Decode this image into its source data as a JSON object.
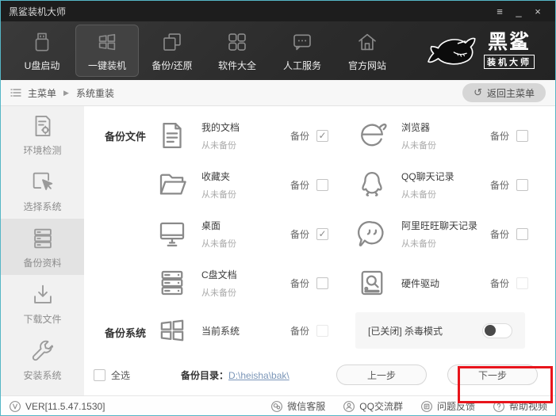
{
  "titlebar": {
    "title": "黑鲨装机大师",
    "menu_glyph": "≡",
    "minimize_glyph": "_",
    "close_glyph": "×"
  },
  "nav": {
    "items": [
      {
        "label": "U盘启动",
        "icon": "usb-icon",
        "active": false
      },
      {
        "label": "一键装机",
        "icon": "onekey-install-icon",
        "active": true
      },
      {
        "label": "备份/还原",
        "icon": "backup-restore-icon",
        "active": false
      },
      {
        "label": "软件大全",
        "icon": "software-icon",
        "active": false
      },
      {
        "label": "人工服务",
        "icon": "support-chat-icon",
        "active": false
      },
      {
        "label": "官方网站",
        "icon": "home-icon",
        "active": false
      }
    ],
    "brand_line1": "黑鲨",
    "brand_line2": "装机大师",
    "brand_icon": "shark-logo"
  },
  "breadcrumb": {
    "root": "主菜单",
    "separator_glyph": "▶",
    "current": "系统重装",
    "back_glyph": "↺",
    "back_label": "返回主菜单"
  },
  "sidebar": {
    "items": [
      {
        "label": "环境检测",
        "icon": "env-check-icon",
        "active": false
      },
      {
        "label": "选择系统",
        "icon": "select-system-icon",
        "active": false
      },
      {
        "label": "备份资料",
        "icon": "backup-data-icon",
        "active": true
      },
      {
        "label": "下载文件",
        "icon": "download-icon",
        "active": false
      },
      {
        "label": "安装系统",
        "icon": "install-wrench-icon",
        "active": false
      }
    ]
  },
  "main": {
    "section_files_label": "备份文件",
    "section_system_label": "备份系统",
    "backup_label": "备份",
    "items": [
      {
        "title": "我的文档",
        "subtitle": "从未备份",
        "checked": true,
        "icon": "document-icon"
      },
      {
        "title": "浏览器",
        "subtitle": "从未备份",
        "checked": false,
        "icon": "ie-browser-icon"
      },
      {
        "title": "收藏夹",
        "subtitle": "从未备份",
        "checked": false,
        "icon": "folder-icon"
      },
      {
        "title": "QQ聊天记录",
        "subtitle": "从未备份",
        "checked": false,
        "icon": "qq-penguin-icon"
      },
      {
        "title": "桌面",
        "subtitle": "从未备份",
        "checked": true,
        "icon": "desktop-monitor-icon"
      },
      {
        "title": "阿里旺旺聊天记录",
        "subtitle": "从未备份",
        "checked": false,
        "icon": "wangwang-bubble-icon"
      },
      {
        "title": "C盘文档",
        "subtitle": "从未备份",
        "checked": false,
        "icon": "c-drive-icon"
      },
      {
        "title": "硬件驱动",
        "subtitle": "",
        "checked": false,
        "muted": true,
        "icon": "hardware-driver-icon"
      }
    ],
    "system_item": {
      "title": "当前系统",
      "subtitle": "",
      "checked": false,
      "muted": true,
      "icon": "windows-logo-icon"
    },
    "antivirus_label": "[已关闭] 杀毒模式",
    "antivirus_state": "off",
    "select_all_label": "全选",
    "select_all_checked": false,
    "backup_dir_label": "备份目录：",
    "backup_dir_value": "D:\\heisha\\bak\\",
    "prev_label": "上一步",
    "next_label": "下一步"
  },
  "annotation": {
    "highlight_color": "#e8141b",
    "target": "next-button"
  },
  "footer": {
    "version": "VER[11.5.47.1530]",
    "version_icon": "v-circle-icon",
    "links": [
      {
        "label": "微信客服",
        "icon": "wechat-icon"
      },
      {
        "label": "QQ交流群",
        "icon": "qq-group-icon"
      },
      {
        "label": "问题反馈",
        "icon": "feedback-icon"
      },
      {
        "label": "帮助视频",
        "icon": "help-icon"
      }
    ]
  },
  "colors": {
    "dark_bg": "#2b2b2b",
    "accent_red": "#e8141b",
    "window_border": "#55b6c6",
    "sidebar_bg": "#f1f1f1"
  }
}
